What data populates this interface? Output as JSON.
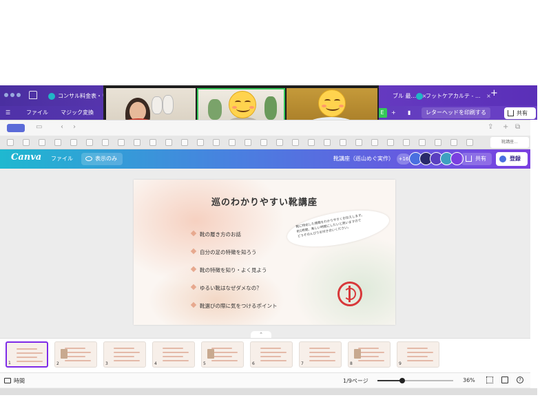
{
  "chrome": {
    "tabs": [
      {
        "label": "コンサル料金表・リ...",
        "close": "×"
      },
      {
        "label": "ブル 最...",
        "close": "×"
      },
      {
        "label": "フットケアカルテ - ...",
        "close": "×"
      }
    ],
    "new_tab": "+",
    "menu_file": "ファイル",
    "magic_switch": "マジック変換",
    "print_letterhead": "レターヘッドを印刷する",
    "share": "共有",
    "green_badge": "E",
    "accent": "#6b3fc4"
  },
  "safari": {
    "active_tab_label": "靴講座..."
  },
  "canva": {
    "logo": "Canva",
    "file_menu": "ファイル",
    "view_only": "表示のみ",
    "doc_title": "靴講座（巡山めぐ実作）",
    "collaborator_count": "+16",
    "share": "共有",
    "login": "登録",
    "avatar_colors": [
      "#4a6fe0",
      "#2a2a6a",
      "#5a3fc0",
      "#3fa0c0",
      "#7a3fe0",
      "#222244"
    ]
  },
  "slide": {
    "title": "巡のわかりやすい靴講座",
    "items": [
      "靴の履き方のお話",
      "自分の足の特徴を知ろう",
      "靴の特徴を知り・よく見よう",
      "ゆるい靴はなぜダメなの？",
      "靴選びの際に気をつけるポイント"
    ],
    "bubble_lines": [
      "靴に特化した情報をわかりやすくお伝えします。",
      "約1時間、楽しい時間にしたいと思いますので",
      "どうぞのんびりお付き合いください。"
    ],
    "stamp_color": "#d8383a"
  },
  "thumbnails": [
    {
      "num": "1",
      "selected": true
    },
    {
      "num": "2",
      "selected": false
    },
    {
      "num": "3",
      "selected": false
    },
    {
      "num": "4",
      "selected": false
    },
    {
      "num": "5",
      "selected": false
    },
    {
      "num": "6",
      "selected": false
    },
    {
      "num": "7",
      "selected": false
    },
    {
      "num": "8",
      "selected": false
    },
    {
      "num": "9",
      "selected": false
    }
  ],
  "footer": {
    "time_label": "時間",
    "page_indicator": "1/9ページ",
    "zoom": "36%",
    "zoom_fraction": 0.33,
    "help": "?"
  }
}
